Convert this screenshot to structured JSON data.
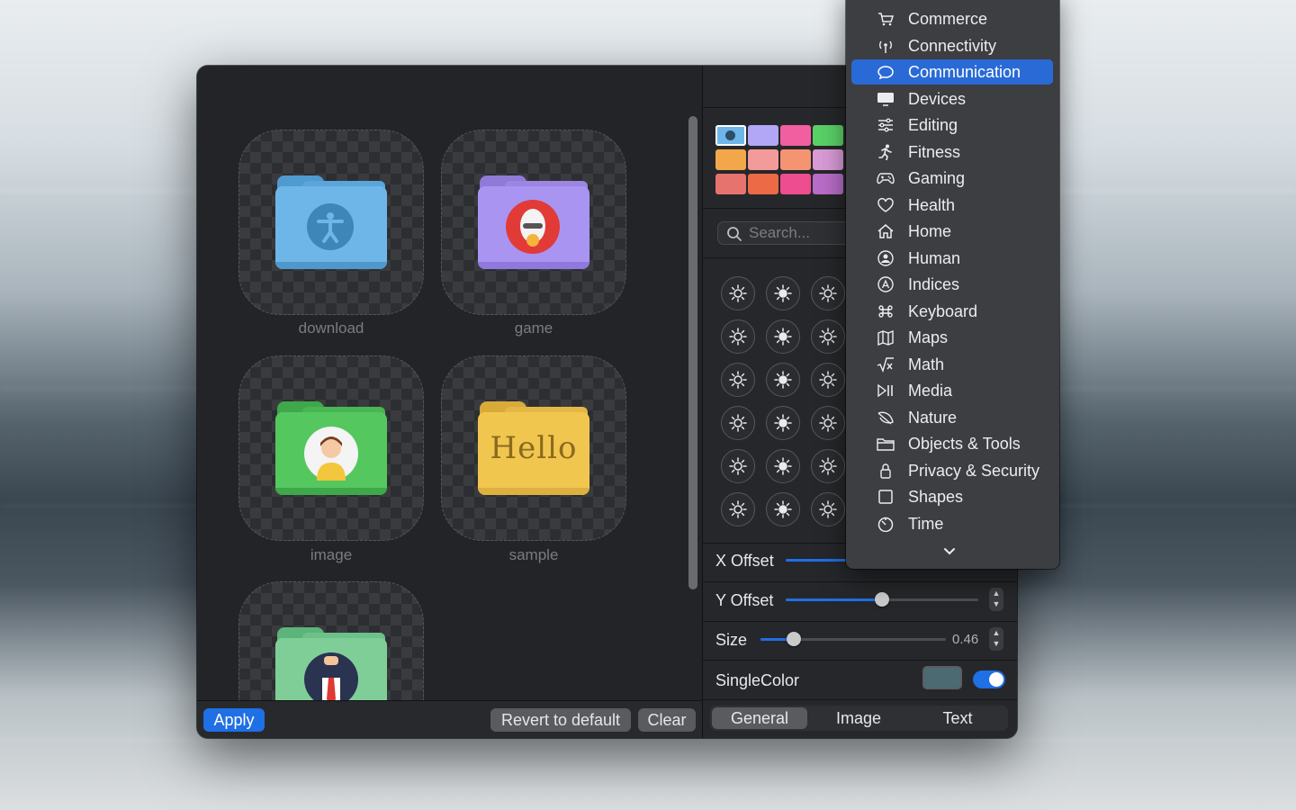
{
  "window": {
    "tiles": [
      {
        "label": "download",
        "folder_color": "#6fb6e8",
        "badge_icon": "accessibility-icon"
      },
      {
        "label": "game",
        "folder_color": "#a994f2",
        "badge_icon": "skateboarder-icon"
      },
      {
        "label": "image",
        "folder_color": "#55c75f",
        "badge_icon": "girl-avatar-icon"
      },
      {
        "label": "sample",
        "folder_color": "#f1c64f",
        "badge_text": "Hello"
      },
      {
        "label": "",
        "folder_color": "#7fce98",
        "badge_icon": "businessman-avatar-icon"
      }
    ],
    "bottom": {
      "apply": "Apply",
      "revert": "Revert to default",
      "clear": "Clear"
    }
  },
  "inspector": {
    "swatches": [
      "#6fb6e8",
      "#b2a6f7",
      "#f15fa0",
      "#5ad167",
      "#f2a84a",
      "#f39a9b",
      "#f49473",
      "#d89bd6",
      "#e7736e",
      "#ec6a45",
      "#ee4d8f",
      "#b86dc8"
    ],
    "search_placeholder": "Search...",
    "x_offset_label": "X Offset",
    "y_offset_label": "Y Offset",
    "y_offset_fraction": 0.5,
    "size_label": "Size",
    "size_value": "0.46",
    "size_fraction": 0.18,
    "singlecolor_label": "SingleColor",
    "singlecolor_on": true,
    "tabs": [
      "General",
      "Image",
      "Text"
    ],
    "active_tab": "General",
    "symbols": [
      "sun-min-icon",
      "sun-max-icon",
      "sun-bright-icon",
      "sun-rays-alert-icon",
      "sun-alert-icon",
      "sunrise-icon",
      "sunset-icon",
      "sunset-fill-icon",
      "sun-circle-icon",
      "sun-horizon-circle-icon",
      "sun-horizon-fill-icon",
      "sun-haze-icon",
      "sun-dust-icon",
      "sun-dust-fill-icon",
      "sun-circle-dust-icon",
      "sun-rain-circle-icon",
      "sun-rain-fill-icon",
      "sun-rain-icon"
    ]
  },
  "menu": {
    "items": [
      {
        "label": "Commerce",
        "icon": "cart-icon"
      },
      {
        "label": "Connectivity",
        "icon": "antenna-icon"
      },
      {
        "label": "Communication",
        "icon": "speech-bubble-icon"
      },
      {
        "label": "Devices",
        "icon": "display-icon"
      },
      {
        "label": "Editing",
        "icon": "sliders-icon"
      },
      {
        "label": "Fitness",
        "icon": "running-figure-icon"
      },
      {
        "label": "Gaming",
        "icon": "gamecontroller-icon"
      },
      {
        "label": "Health",
        "icon": "heart-icon"
      },
      {
        "label": "Home",
        "icon": "house-icon"
      },
      {
        "label": "Human",
        "icon": "person-circle-icon"
      },
      {
        "label": "Indices",
        "icon": "a-circle-icon"
      },
      {
        "label": "Keyboard",
        "icon": "command-icon"
      },
      {
        "label": "Maps",
        "icon": "map-icon"
      },
      {
        "label": "Math",
        "icon": "square-root-icon"
      },
      {
        "label": "Media",
        "icon": "play-pause-icon"
      },
      {
        "label": "Nature",
        "icon": "leaf-icon"
      },
      {
        "label": "Objects & Tools",
        "icon": "folder-icon"
      },
      {
        "label": "Privacy & Security",
        "icon": "lock-icon"
      },
      {
        "label": "Shapes",
        "icon": "square-icon"
      },
      {
        "label": "Time",
        "icon": "timer-icon"
      }
    ],
    "selected": "Communication",
    "more_icon": "chevron-down-icon"
  }
}
